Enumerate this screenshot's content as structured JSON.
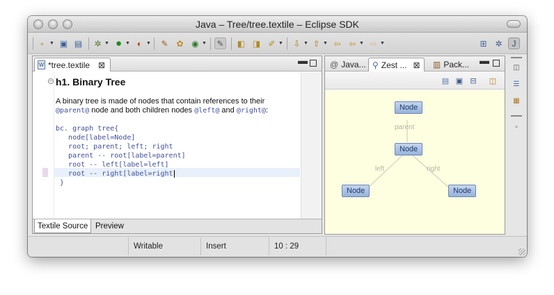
{
  "window": {
    "title": "Java – Tree/tree.textile – Eclipse SDK"
  },
  "editor": {
    "tab_label": "*tree.textile",
    "tab_file_icon": "W",
    "lines": {
      "heading": "h1. Binary Tree",
      "p1": "A binary tree is made of nodes that contain references to their",
      "p2_parent": "@parent@",
      "p2_mid": " node and both children nodes ",
      "p2_left": "@left@",
      "p2_and": " and ",
      "p2_right": "@right@",
      "p2_colon": ":",
      "bc": "bc. graph tree{",
      "c1": "   node[label=Node]",
      "c2": "   root; parent; left; right",
      "c3": "   parent -- root[label=parent]",
      "c4": "   root -- left[label=left]",
      "c5": "   root -- right[label=right",
      "c6": " }"
    },
    "bottom_tabs": [
      "Textile Source",
      "Preview"
    ]
  },
  "zest_view": {
    "tabs": [
      "Java...",
      "Zest ...",
      "Pack..."
    ],
    "nodes": [
      "Node",
      "Node",
      "Node",
      "Node"
    ],
    "edge_labels": [
      "parent",
      "left",
      "right"
    ],
    "canvas_color": "#fefee0"
  },
  "status": {
    "writable": "Writable",
    "insert": "Insert",
    "position": "10 : 29"
  },
  "icons": [
    "new-icon",
    "save-icon",
    "print-icon",
    "debug-icon",
    "run-icon",
    "external-tools-icon",
    "new-java-project-icon",
    "new-package-icon",
    "new-class-icon",
    "open-type-icon",
    "search-icon",
    "next-annotation-icon",
    "back-icon",
    "forward-icon",
    "open-perspective-icon",
    "java-perspective-icon"
  ]
}
